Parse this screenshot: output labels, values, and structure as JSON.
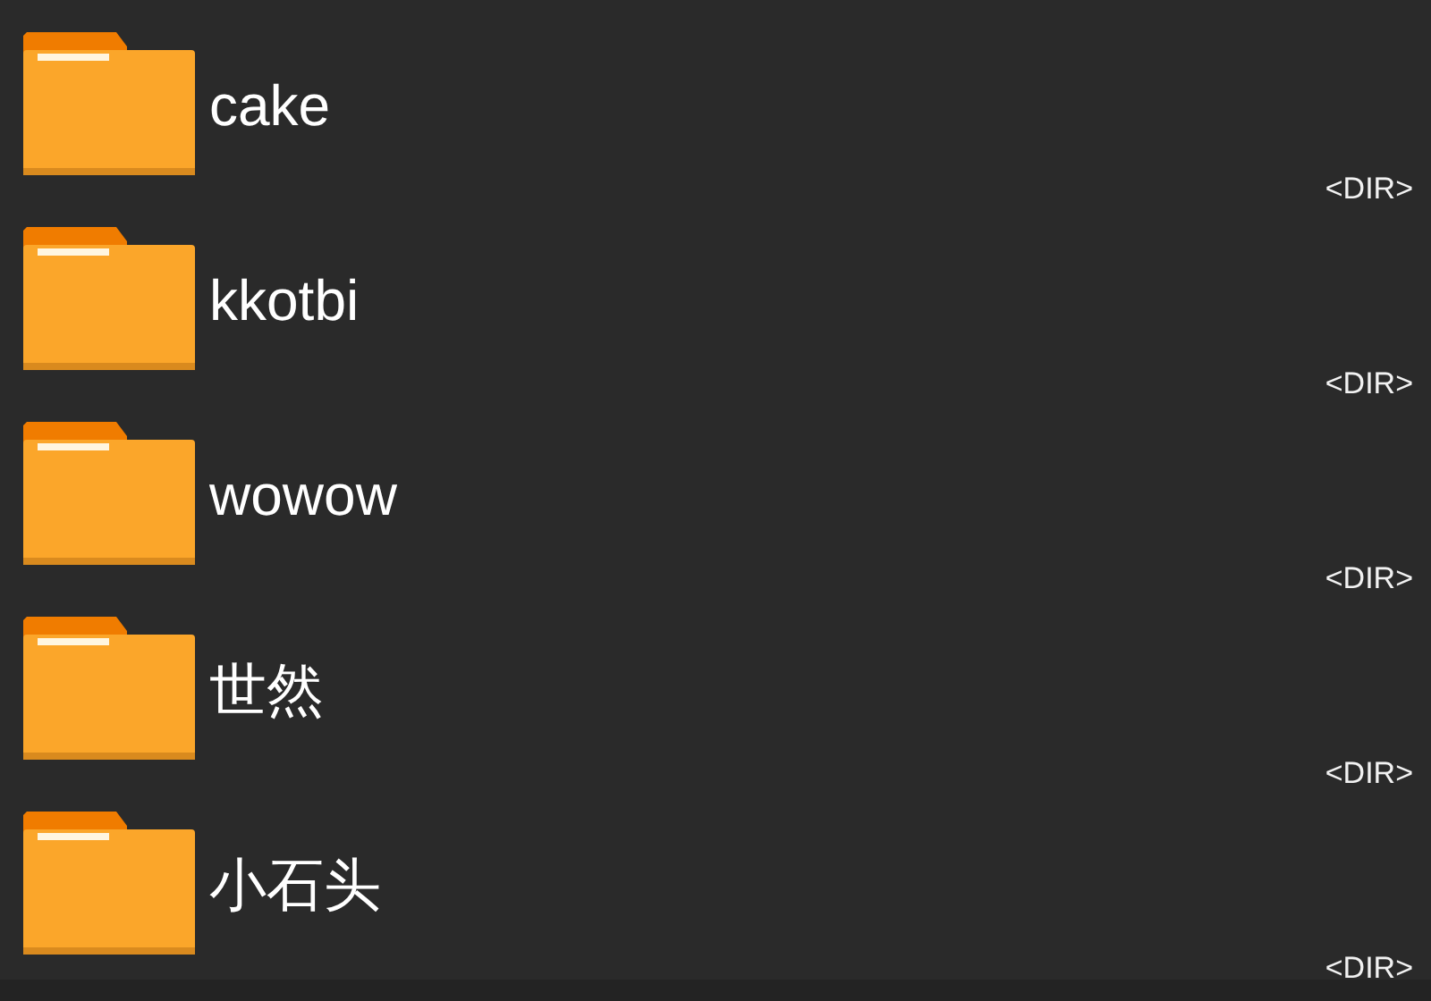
{
  "files": [
    {
      "name": "cake",
      "type": "<DIR>"
    },
    {
      "name": "kkotbi",
      "type": "<DIR>"
    },
    {
      "name": "wowow",
      "type": "<DIR>"
    },
    {
      "name": "世然",
      "type": "<DIR>"
    },
    {
      "name": "小石头",
      "type": "<DIR>"
    }
  ]
}
